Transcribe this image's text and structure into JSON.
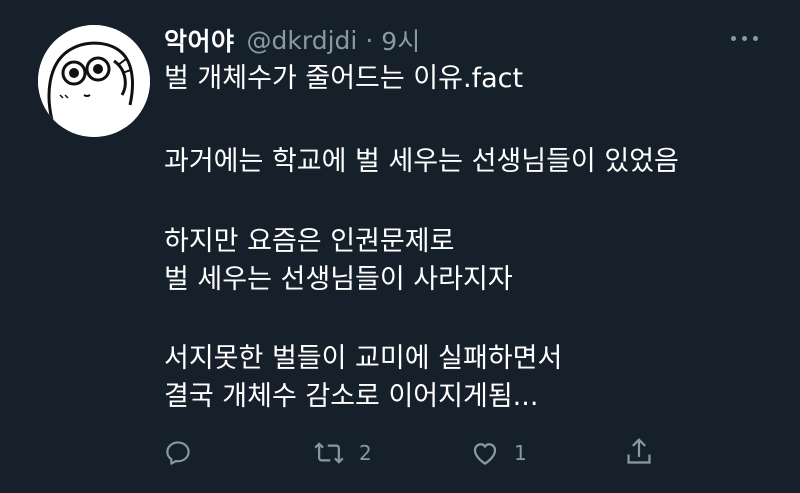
{
  "author": {
    "display_name": "악어야",
    "handle": "@dkrdjdi",
    "separator": "·",
    "time": "9시"
  },
  "tweet_lines": [
    "벌 개체수가 줄어드는 이유.fact",
    "과거에는 학교에 벌 세우는 선생님들이 있었음",
    "하지만 요즘은 인권문제로",
    "벌 세우는 선생님들이 사라지자",
    "서지못한 벌들이 교미에 실패하면서",
    "결국 개체수 감소로 이어지게됨..."
  ],
  "actions": {
    "reply_icon": "reply-icon",
    "retweet_icon": "retweet-icon",
    "retweet_count": "2",
    "like_icon": "heart-icon",
    "like_count": "1",
    "share_icon": "share-icon"
  },
  "colors": {
    "background": "#15202b",
    "text": "#ffffff",
    "muted": "#8899a6"
  }
}
